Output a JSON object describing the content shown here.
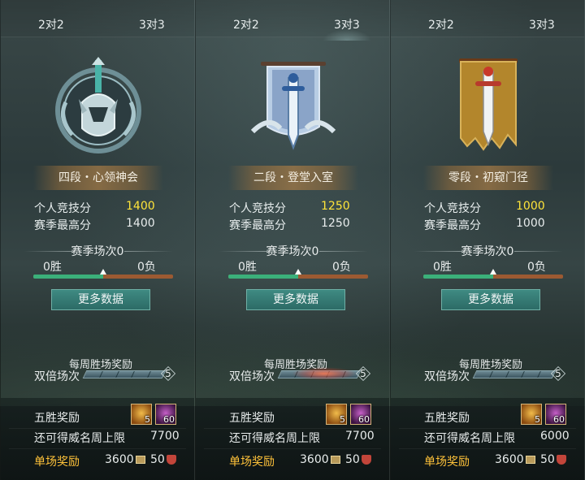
{
  "panels": [
    {
      "tabs": {
        "left": "2对2",
        "right": "3对3"
      },
      "rank": "四段・心领神会",
      "emblem_icon": "silver-armor-emblem-icon",
      "stats": {
        "personal_label": "个人竞技分",
        "personal_value": "1400",
        "season_label": "赛季最高分",
        "season_value": "1400"
      },
      "season": {
        "title": "赛季场次0",
        "wins": "0胜",
        "losses": "0负",
        "win_ratio": 0.5
      },
      "more_button": "更多数据",
      "weekly": {
        "title": "每周胜场奖励",
        "double_label": "双倍场次",
        "double_count": "5"
      },
      "five_win": {
        "label": "五胜奖励",
        "item1_count": "5",
        "item2_count": "60"
      },
      "cap": {
        "label": "还可得威名周上限",
        "value": "7700"
      },
      "single": {
        "label": "单场奖励",
        "value1": "3600",
        "value2": "50"
      }
    },
    {
      "tabs": {
        "left": "2对2",
        "right": "3对3"
      },
      "rank": "二段・登堂入室",
      "emblem_icon": "blue-sword-banner-icon",
      "stats": {
        "personal_label": "个人竞技分",
        "personal_value": "1250",
        "season_label": "赛季最高分",
        "season_value": "1250"
      },
      "season": {
        "title": "赛季场次0",
        "wins": "0胜",
        "losses": "0负",
        "win_ratio": 0.5
      },
      "more_button": "更多数据",
      "weekly": {
        "title": "每周胜场奖励",
        "double_label": "双倍场次",
        "double_count": "5"
      },
      "five_win": {
        "label": "五胜奖励",
        "item1_count": "5",
        "item2_count": "60"
      },
      "cap": {
        "label": "还可得威名周上限",
        "value": "7700"
      },
      "single": {
        "label": "单场奖励",
        "value1": "3600",
        "value2": "50"
      }
    },
    {
      "tabs": {
        "left": "2对2",
        "right": "3对3"
      },
      "rank": "零段・初窥门径",
      "emblem_icon": "gold-sword-banner-icon",
      "stats": {
        "personal_label": "个人竞技分",
        "personal_value": "1000",
        "season_label": "赛季最高分",
        "season_value": "1000"
      },
      "season": {
        "title": "赛季场次0",
        "wins": "0胜",
        "losses": "0负",
        "win_ratio": 0.5
      },
      "more_button": "更多数据",
      "weekly": {
        "title": "每周胜场奖励",
        "double_label": "双倍场次",
        "double_count": "5"
      },
      "five_win": {
        "label": "五胜奖励",
        "item1_count": "5",
        "item2_count": "60"
      },
      "cap": {
        "label": "还可得威名周上限",
        "value": "6000"
      },
      "single": {
        "label": "单场奖励",
        "value1": "3600",
        "value2": "50"
      }
    }
  ],
  "colors": {
    "score": "#ffe43a",
    "reward_label": "#ffc23a",
    "win_bar": "#3bb07a",
    "loss_bar": "#9c5a32"
  }
}
